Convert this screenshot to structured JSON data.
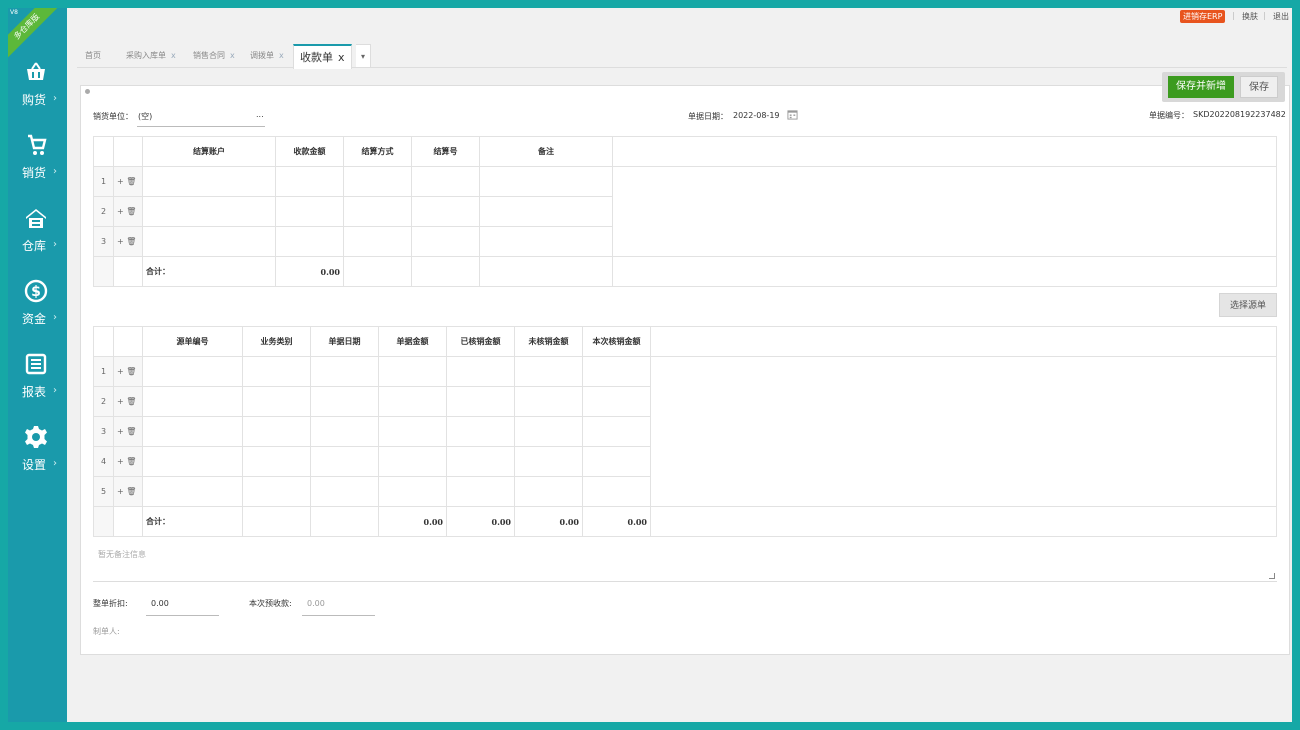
{
  "sidebar": {
    "corner_ribbon": "多仓库版",
    "corner_version": "V8",
    "items": [
      {
        "label": "购货",
        "icon": "basket-icon"
      },
      {
        "label": "销货",
        "icon": "cart-icon"
      },
      {
        "label": "仓库",
        "icon": "warehouse-icon"
      },
      {
        "label": "资金",
        "icon": "dollar-icon"
      },
      {
        "label": "报表",
        "icon": "report-icon"
      },
      {
        "label": "设置",
        "icon": "gear-icon"
      }
    ]
  },
  "topbar": {
    "erp_badge": "进销存ERP",
    "skin": "换肤",
    "logout": "退出"
  },
  "tabs": [
    {
      "label": "首页"
    },
    {
      "label": "采购入库单"
    },
    {
      "label": "销售合同"
    },
    {
      "label": "调拨单"
    },
    {
      "label": "收款单",
      "active": true
    }
  ],
  "tab_close": "x",
  "actions": {
    "save_and_new": "保存并新增",
    "save": "保存",
    "select_source": "选择源单"
  },
  "form": {
    "customer_label": "销货单位：",
    "customer_value": "(空)",
    "customer_more": "...",
    "date_label": "单据日期：",
    "date_value": "2022-08-19",
    "number_label": "单据编号：",
    "number_value": "SKD202208192237482"
  },
  "account_table": {
    "headers": [
      "结算账户",
      "收款金额",
      "结算方式",
      "结算号",
      "备注"
    ],
    "rows": [
      "1",
      "2",
      "3"
    ],
    "ops": "+ 🗑",
    "total_label": "合计：",
    "total_amount": "0.00"
  },
  "source_table": {
    "headers": [
      "源单编号",
      "业务类别",
      "单据日期",
      "单据金额",
      "已核销金额",
      "未核销金额",
      "本次核销金额"
    ],
    "rows": [
      "1",
      "2",
      "3",
      "4",
      "5"
    ],
    "ops": "+ 🗑",
    "total_label": "合计：",
    "totals": [
      "0.00",
      "0.00",
      "0.00",
      "0.00"
    ]
  },
  "remark_placeholder": "暂无备注信息",
  "footer": {
    "discount_label": "整单折扣:",
    "discount_value": "0.00",
    "advance_label": "本次预收款:",
    "advance_value": "0.00",
    "maker_label": "制单人:"
  },
  "colors": {
    "sidebar": "#1a9aab",
    "primary_button": "#3c9b1f",
    "erp_badge": "#e8541e"
  }
}
